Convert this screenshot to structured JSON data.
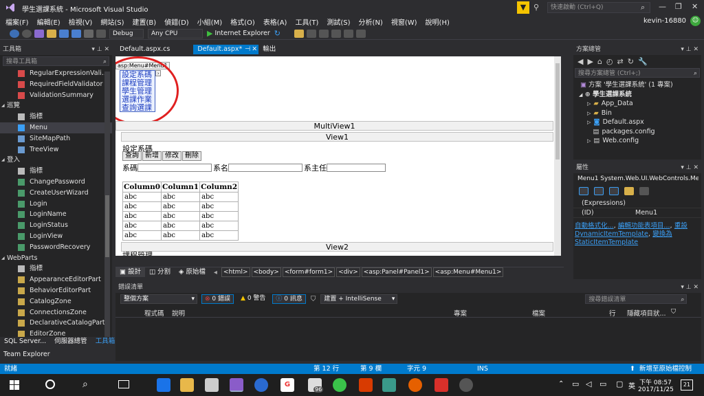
{
  "title": "學生選課系統 - Microsoft Visual Studio",
  "quick_launch": "快速啟動 (Ctrl+Q)",
  "user": "kevin-16880",
  "menu": [
    "檔案(F)",
    "編輯(E)",
    "檢視(V)",
    "網站(S)",
    "建置(B)",
    "偵錯(D)",
    "小組(M)",
    "格式(O)",
    "表格(A)",
    "工具(T)",
    "測試(S)",
    "分析(N)",
    "視窗(W)",
    "說明(H)"
  ],
  "toolbar": {
    "config": "Debug",
    "platform": "Any CPU",
    "run": "Internet Explorer"
  },
  "toolbox": {
    "title": "工具箱",
    "search": "搜尋工具箱",
    "items": [
      {
        "kind": "item",
        "label": "RegularExpressionVali..."
      },
      {
        "kind": "item",
        "label": "RequiredFieldValidator"
      },
      {
        "kind": "item",
        "label": "ValidationSummary"
      },
      {
        "kind": "group",
        "label": "巡覽"
      },
      {
        "kind": "item",
        "label": "指標"
      },
      {
        "kind": "item",
        "label": "Menu"
      },
      {
        "kind": "item",
        "label": "SiteMapPath"
      },
      {
        "kind": "item",
        "label": "TreeView"
      },
      {
        "kind": "group",
        "label": "登入"
      },
      {
        "kind": "item",
        "label": "指標"
      },
      {
        "kind": "item",
        "label": "ChangePassword"
      },
      {
        "kind": "item",
        "label": "CreateUserWizard"
      },
      {
        "kind": "item",
        "label": "Login"
      },
      {
        "kind": "item",
        "label": "LoginName"
      },
      {
        "kind": "item",
        "label": "LoginStatus"
      },
      {
        "kind": "item",
        "label": "LoginView"
      },
      {
        "kind": "item",
        "label": "PasswordRecovery"
      },
      {
        "kind": "group",
        "label": "WebParts"
      },
      {
        "kind": "item",
        "label": "指標"
      },
      {
        "kind": "item",
        "label": "AppearanceEditorPart"
      },
      {
        "kind": "item",
        "label": "BehaviorEditorPart"
      },
      {
        "kind": "item",
        "label": "CatalogZone"
      },
      {
        "kind": "item",
        "label": "ConnectionsZone"
      },
      {
        "kind": "item",
        "label": "DeclarativeCatalogPart"
      },
      {
        "kind": "item",
        "label": "EditorZone"
      }
    ],
    "bottom_tabs": [
      "SQL Server...",
      "伺服器總管",
      "工具箱"
    ],
    "team_explorer": "Team Explorer"
  },
  "doc_tabs": [
    "Default.aspx.cs",
    "Default.aspx*",
    "輸出"
  ],
  "design": {
    "menu_tag": "asp:Menu#Menu1",
    "menu_items": [
      "設定系碼",
      "課程管理",
      "學生管理",
      "選課作業",
      "查詢選課"
    ],
    "multiview": "MultiView1",
    "view1": "View1",
    "view2": "View2",
    "section_title": "設定系碼",
    "buttons": [
      "查詢",
      "新增",
      "修改",
      "刪除"
    ],
    "field1": "系碼",
    "field2": "系名",
    "field3": "系主任",
    "grid_headers": [
      "Column0",
      "Column1",
      "Column2"
    ],
    "grid_cell": "abc",
    "next_section": "課程管理"
  },
  "view_tabs": [
    "設計",
    "分割",
    "原始檔"
  ],
  "breadcrumb": [
    "<html>",
    "<body>",
    "<form#form1>",
    "<div>",
    "<asp:Panel#Panel1>",
    "<asp:Menu#Menu1>"
  ],
  "errorlist": {
    "title": "錯誤清單",
    "scope": "整個方案",
    "errors": "0 錯誤",
    "warnings": "0 警告",
    "messages": "0 訊息",
    "build": "建置 + IntelliSense",
    "search": "搜尋錯誤清單",
    "columns": [
      "程式碼",
      "說明",
      "專案",
      "檔案",
      "行",
      "隱藏項目狀..."
    ]
  },
  "solution": {
    "title": "方案總管",
    "search": "搜尋方案總管 (Ctrl+;)",
    "root": "方案 '學生選課系統' (1 專案)",
    "project": "學生選課系統",
    "items": [
      "App_Data",
      "Bin",
      "Default.aspx",
      "packages.config",
      "Web.config"
    ]
  },
  "properties": {
    "title": "屬性",
    "object": "Menu1  System.Web.UI.WebControls.Me",
    "rows": [
      {
        "name": "(Expressions)",
        "value": ""
      },
      {
        "name": "(ID)",
        "value": "Menu1"
      }
    ],
    "links": [
      "自動格式化...",
      "編輯功能表項目...",
      "重設",
      "DynamicItemTemplate",
      "變換為",
      "StaticItemTemplate"
    ]
  },
  "status": {
    "left": "就緒",
    "line": "第 12 行",
    "col": "第 9 欄",
    "char": "字元 9",
    "mode": "INS",
    "right": "新增至原始檔控制"
  },
  "taskbar": {
    "ime": "英",
    "time": "下午 08:57",
    "date": "2017/11/25",
    "badge": "96",
    "notif": "21"
  }
}
